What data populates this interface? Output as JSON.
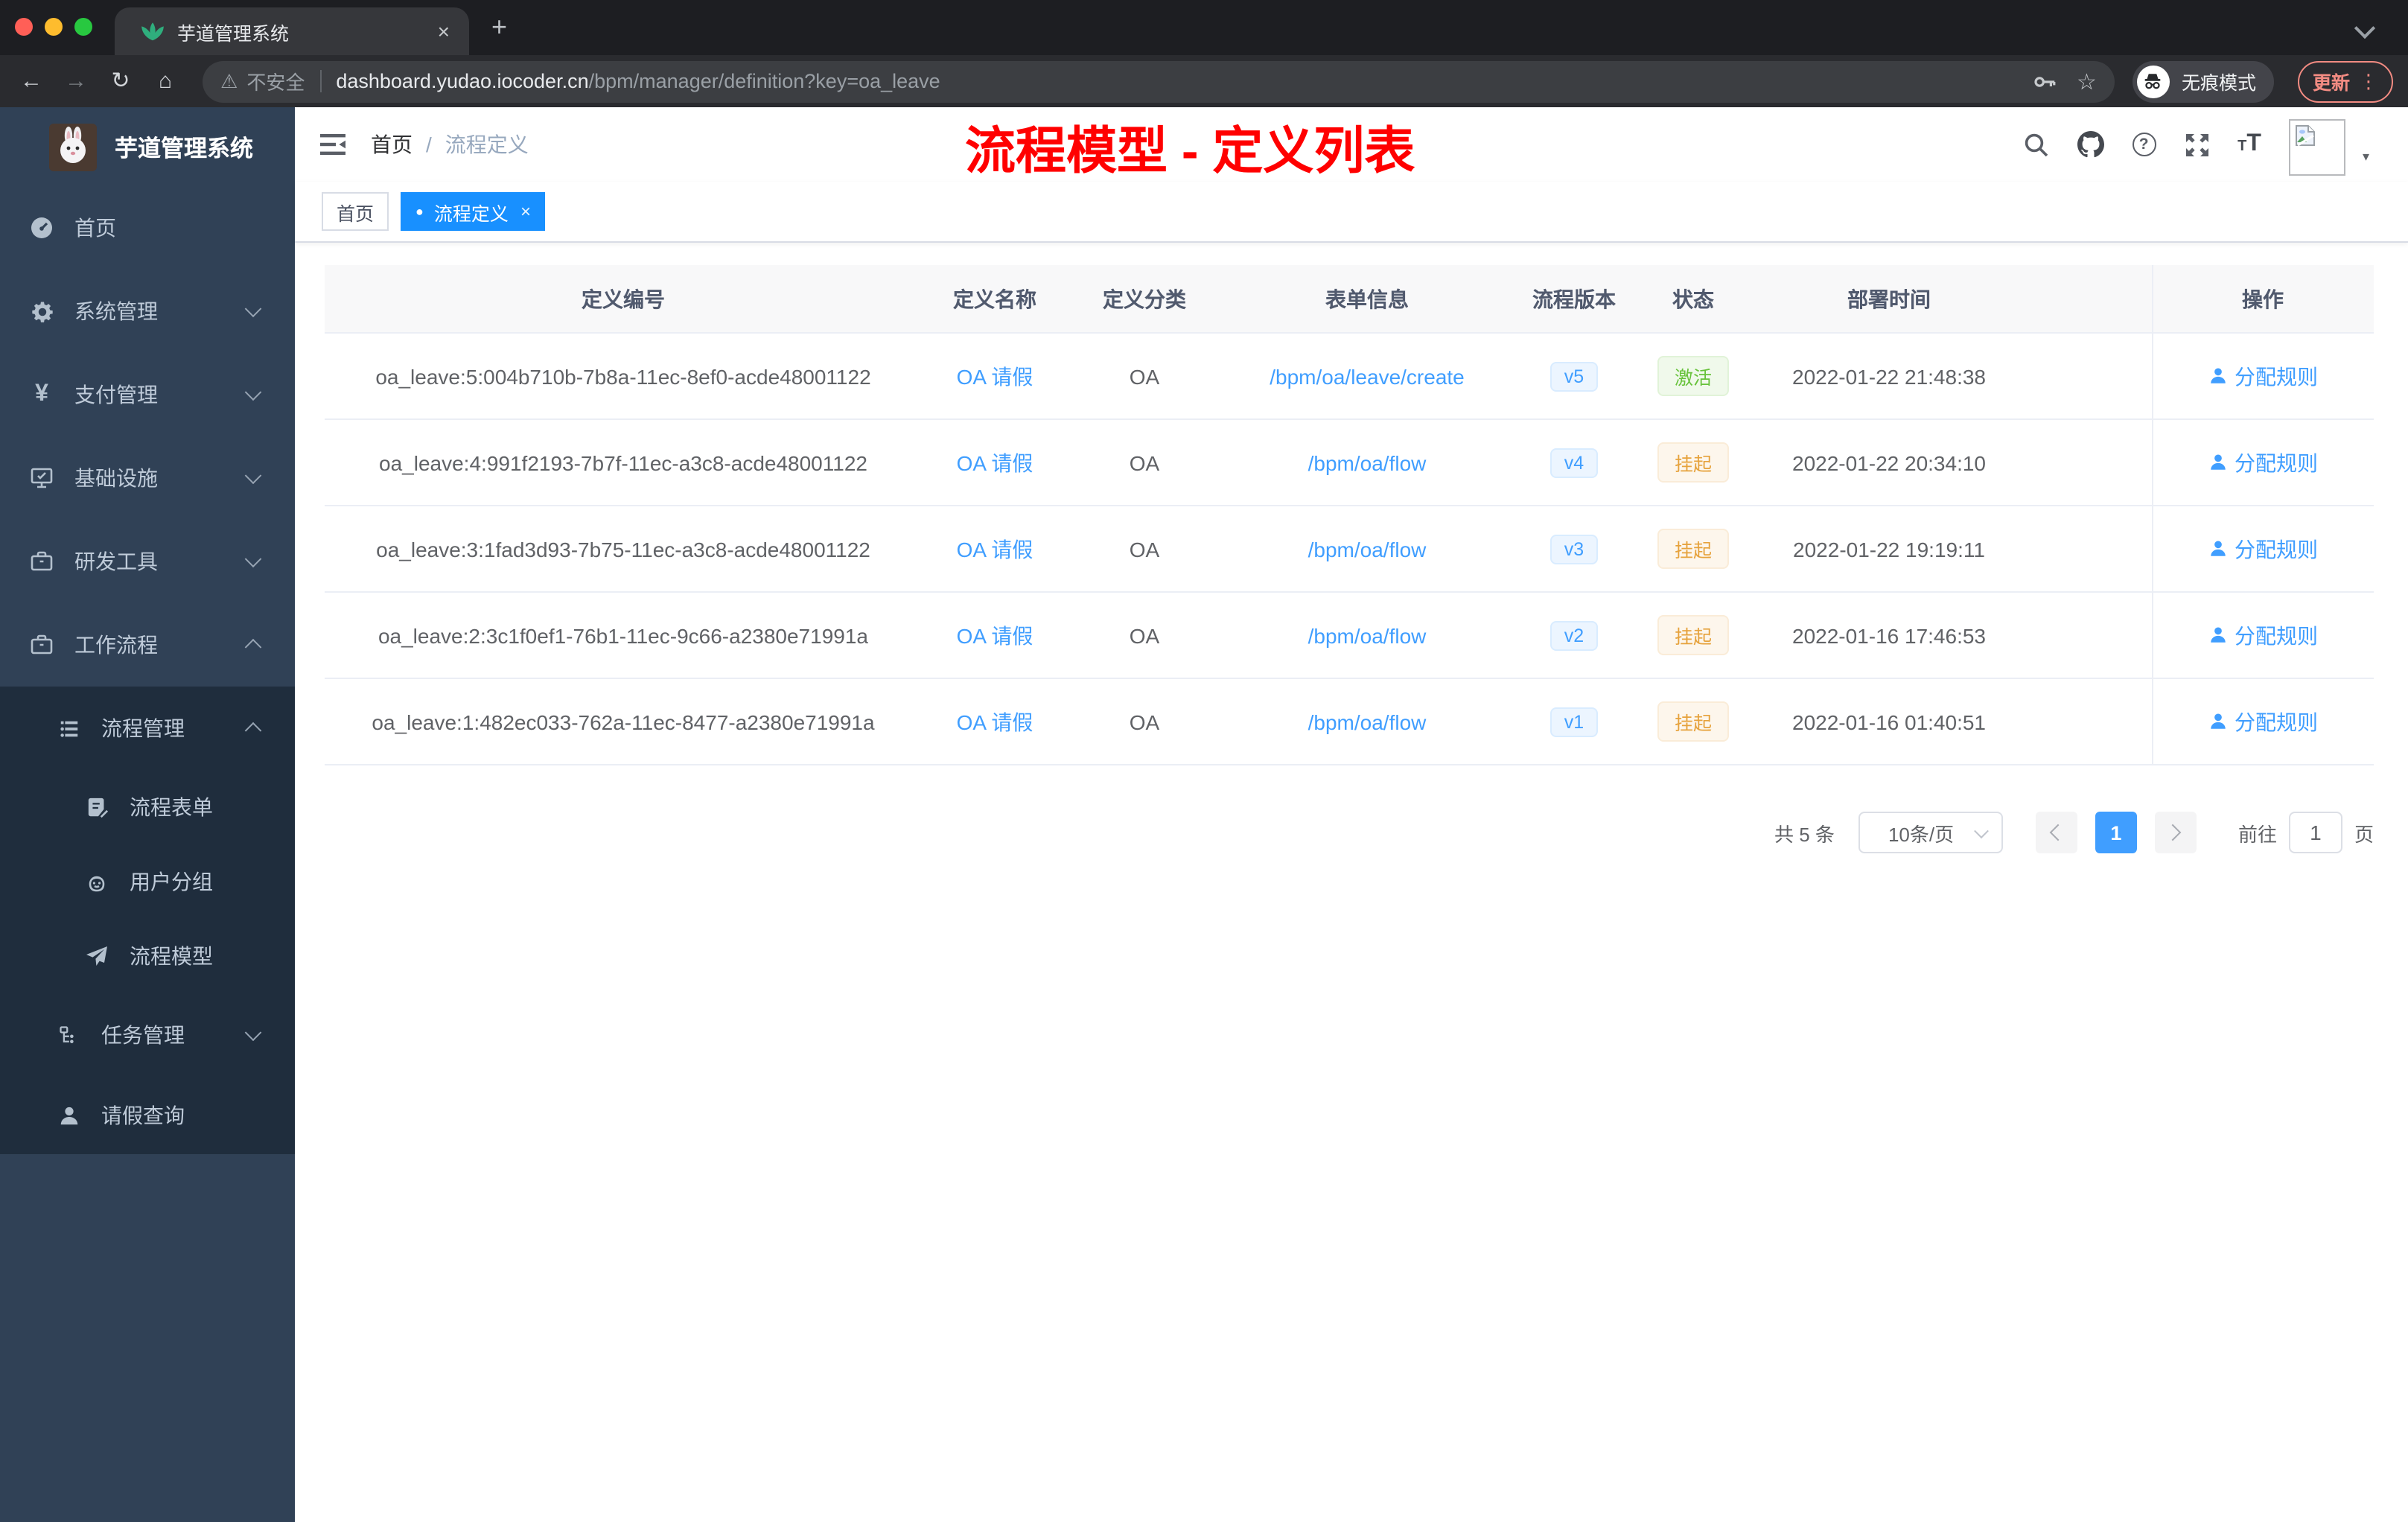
{
  "browser": {
    "tab_title": "芋道管理系统",
    "url_host": "dashboard.yudao.iocoder.cn",
    "url_path": "/bpm/manager/definition?key=oa_leave",
    "security_label": "不安全",
    "incognito_label": "无痕模式",
    "update_label": "更新"
  },
  "icons": {
    "back": "←",
    "forward": "→",
    "reload": "↻",
    "home": "⌂",
    "warning": "⚠",
    "star": "☆",
    "dots": "⋮",
    "close": "×",
    "new_tab": "+",
    "caret_down": "▾",
    "question": "?",
    "font_small": "T",
    "font_big": "T",
    "tag_dot": "●",
    "tag_close": "×"
  },
  "sidebar": {
    "brand": "芋道管理系统",
    "items": [
      {
        "label": "首页"
      },
      {
        "label": "系统管理"
      },
      {
        "label": "支付管理"
      },
      {
        "label": "基础设施"
      },
      {
        "label": "研发工具"
      },
      {
        "label": "工作流程"
      },
      {
        "label": "流程管理"
      },
      {
        "label": "流程表单"
      },
      {
        "label": "用户分组"
      },
      {
        "label": "流程模型"
      },
      {
        "label": "任务管理"
      },
      {
        "label": "请假查询"
      }
    ]
  },
  "header": {
    "breadcrumb": [
      "首页",
      "流程定义"
    ],
    "separator": "/",
    "annotation": "流程模型 - 定义列表"
  },
  "tags": [
    {
      "label": "首页",
      "active": false
    },
    {
      "label": "流程定义",
      "active": true
    }
  ],
  "table": {
    "columns": [
      "定义编号",
      "定义名称",
      "定义分类",
      "表单信息",
      "流程版本",
      "状态",
      "部署时间",
      "操作"
    ],
    "rows": [
      {
        "id": "oa_leave:5:004b710b-7b8a-11ec-8ef0-acde48001122",
        "name": "OA 请假",
        "category": "OA",
        "form": "/bpm/oa/leave/create",
        "version": "v5",
        "status": "激活",
        "status_type": "active",
        "deployed_at": "2022-01-22 21:48:38",
        "action": "分配规则"
      },
      {
        "id": "oa_leave:4:991f2193-7b7f-11ec-a3c8-acde48001122",
        "name": "OA 请假",
        "category": "OA",
        "form": "/bpm/oa/flow",
        "version": "v4",
        "status": "挂起",
        "status_type": "suspended",
        "deployed_at": "2022-01-22 20:34:10",
        "action": "分配规则"
      },
      {
        "id": "oa_leave:3:1fad3d93-7b75-11ec-a3c8-acde48001122",
        "name": "OA 请假",
        "category": "OA",
        "form": "/bpm/oa/flow",
        "version": "v3",
        "status": "挂起",
        "status_type": "suspended",
        "deployed_at": "2022-01-22 19:19:11",
        "action": "分配规则"
      },
      {
        "id": "oa_leave:2:3c1f0ef1-76b1-11ec-9c66-a2380e71991a",
        "name": "OA 请假",
        "category": "OA",
        "form": "/bpm/oa/flow",
        "version": "v2",
        "status": "挂起",
        "status_type": "suspended",
        "deployed_at": "2022-01-16 17:46:53",
        "action": "分配规则"
      },
      {
        "id": "oa_leave:1:482ec033-762a-11ec-8477-a2380e71991a",
        "name": "OA 请假",
        "category": "OA",
        "form": "/bpm/oa/flow",
        "version": "v1",
        "status": "挂起",
        "status_type": "suspended",
        "deployed_at": "2022-01-16 01:40:51",
        "action": "分配规则"
      }
    ]
  },
  "pagination": {
    "total": "共 5 条",
    "page_size": "10条/页",
    "current": "1",
    "goto_prefix": "前往",
    "goto_value": "1",
    "goto_suffix": "页"
  },
  "colors": {
    "accent": "#409eff",
    "tag_active": "#1890ff",
    "status_active": "#67c23a",
    "status_suspended": "#e6a23c",
    "annotation": "#ff0000"
  }
}
